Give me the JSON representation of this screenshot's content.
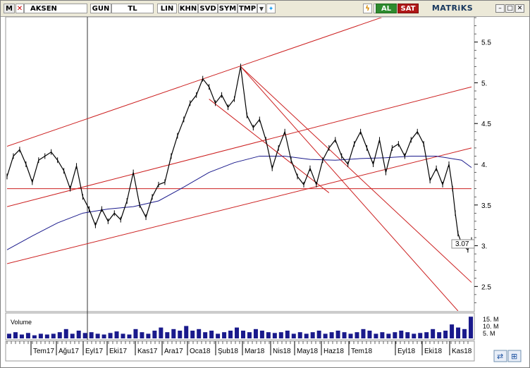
{
  "toolbar": {
    "logo": "M",
    "symbol": "AKSEN",
    "period": "GUN",
    "currency": "TL",
    "scale": "LIN",
    "buttons": [
      "KHN",
      "SVD",
      "SYM",
      "TMP"
    ],
    "buy": "AL",
    "sell": "SAT",
    "brand": "MATRiKS",
    "icons": [
      "close-icon",
      "dropdown-icon",
      "twitter-icon",
      "lightning-icon",
      "refresh-icon",
      "minimize-icon",
      "maximize-icon",
      "close-window-icon"
    ],
    "colors": {
      "buy": "#2e8b2e",
      "sell": "#b01818",
      "brand": "#17375e"
    }
  },
  "chart_data": {
    "type": "line",
    "title": "",
    "last_price": "3.07",
    "y_ticks": [
      "5.5",
      "5.",
      "4.5",
      "4.",
      "3.5",
      "3.",
      "2.5"
    ],
    "ylim": [
      2.2,
      5.8
    ],
    "x_labels": [
      "Tem17",
      "Ağu17",
      "Eyl17",
      "Eki17",
      "Kas17",
      "Ara17",
      "Oca18",
      "Şub18",
      "Mar18",
      "Nis18",
      "May18",
      "Haz18",
      "Tem18",
      "Eyl18",
      "Eki18",
      "Kas18"
    ],
    "x_range": [
      "2017-06-19",
      "2018-11-16"
    ],
    "volume_label": "Volume",
    "volume_ticks": [
      "15. M",
      "10. M",
      "5. M"
    ],
    "colors": {
      "price": "#000000",
      "moving_average": "#1a1a8c",
      "trendlines": "#cc2020",
      "volume": "#1a1a8c"
    },
    "price_series": [
      [
        "2017-06-19",
        3.85
      ],
      [
        "2017-06-26",
        4.1
      ],
      [
        "2017-07-03",
        4.18
      ],
      [
        "2017-07-10",
        4.0
      ],
      [
        "2017-07-17",
        3.78
      ],
      [
        "2017-07-24",
        4.05
      ],
      [
        "2017-07-31",
        4.1
      ],
      [
        "2017-08-07",
        4.15
      ],
      [
        "2017-08-14",
        4.05
      ],
      [
        "2017-08-21",
        3.92
      ],
      [
        "2017-08-28",
        3.7
      ],
      [
        "2017-09-04",
        3.98
      ],
      [
        "2017-09-11",
        3.6
      ],
      [
        "2017-09-18",
        3.45
      ],
      [
        "2017-09-25",
        3.25
      ],
      [
        "2017-10-02",
        3.45
      ],
      [
        "2017-10-09",
        3.3
      ],
      [
        "2017-10-16",
        3.4
      ],
      [
        "2017-10-23",
        3.32
      ],
      [
        "2017-10-30",
        3.55
      ],
      [
        "2017-11-06",
        3.9
      ],
      [
        "2017-11-13",
        3.5
      ],
      [
        "2017-11-20",
        3.35
      ],
      [
        "2017-11-27",
        3.6
      ],
      [
        "2017-12-04",
        3.75
      ],
      [
        "2017-12-11",
        3.78
      ],
      [
        "2017-12-18",
        4.1
      ],
      [
        "2017-12-25",
        4.35
      ],
      [
        "2018-01-01",
        4.55
      ],
      [
        "2018-01-08",
        4.75
      ],
      [
        "2018-01-15",
        4.85
      ],
      [
        "2018-01-22",
        5.05
      ],
      [
        "2018-01-29",
        4.95
      ],
      [
        "2018-02-05",
        4.75
      ],
      [
        "2018-02-12",
        4.85
      ],
      [
        "2018-02-19",
        4.7
      ],
      [
        "2018-02-26",
        4.8
      ],
      [
        "2018-03-05",
        5.2
      ],
      [
        "2018-03-12",
        4.6
      ],
      [
        "2018-03-19",
        4.45
      ],
      [
        "2018-03-26",
        4.55
      ],
      [
        "2018-04-02",
        4.3
      ],
      [
        "2018-04-09",
        3.95
      ],
      [
        "2018-04-16",
        4.2
      ],
      [
        "2018-04-23",
        4.4
      ],
      [
        "2018-04-30",
        4.05
      ],
      [
        "2018-05-07",
        3.85
      ],
      [
        "2018-05-14",
        3.75
      ],
      [
        "2018-05-21",
        3.95
      ],
      [
        "2018-05-28",
        3.75
      ],
      [
        "2018-06-04",
        4.05
      ],
      [
        "2018-06-11",
        4.2
      ],
      [
        "2018-06-18",
        4.3
      ],
      [
        "2018-06-25",
        4.1
      ],
      [
        "2018-07-02",
        4.0
      ],
      [
        "2018-07-09",
        4.25
      ],
      [
        "2018-07-16",
        4.4
      ],
      [
        "2018-07-23",
        4.2
      ],
      [
        "2018-07-30",
        4.0
      ],
      [
        "2018-08-06",
        4.3
      ],
      [
        "2018-08-13",
        3.9
      ],
      [
        "2018-08-20",
        4.2
      ],
      [
        "2018-08-27",
        4.25
      ],
      [
        "2018-09-03",
        4.1
      ],
      [
        "2018-09-10",
        4.3
      ],
      [
        "2018-09-17",
        4.4
      ],
      [
        "2018-09-24",
        4.25
      ],
      [
        "2018-10-01",
        3.8
      ],
      [
        "2018-10-08",
        3.95
      ],
      [
        "2018-10-15",
        3.75
      ],
      [
        "2018-10-22",
        4.0
      ],
      [
        "2018-10-26",
        3.7
      ],
      [
        "2018-10-29",
        3.4
      ],
      [
        "2018-11-01",
        3.15
      ],
      [
        "2018-11-06",
        3.0
      ],
      [
        "2018-11-12",
        2.95
      ],
      [
        "2018-11-16",
        3.07
      ]
    ],
    "moving_average": [
      [
        "2017-06-19",
        2.95
      ],
      [
        "2017-07-17",
        3.12
      ],
      [
        "2017-08-14",
        3.28
      ],
      [
        "2017-09-11",
        3.4
      ],
      [
        "2017-10-09",
        3.45
      ],
      [
        "2017-11-06",
        3.48
      ],
      [
        "2017-12-04",
        3.55
      ],
      [
        "2018-01-01",
        3.72
      ],
      [
        "2018-01-29",
        3.9
      ],
      [
        "2018-02-26",
        4.02
      ],
      [
        "2018-03-26",
        4.1
      ],
      [
        "2018-04-23",
        4.1
      ],
      [
        "2018-05-21",
        4.06
      ],
      [
        "2018-06-18",
        4.05
      ],
      [
        "2018-07-16",
        4.07
      ],
      [
        "2018-08-13",
        4.08
      ],
      [
        "2018-09-10",
        4.1
      ],
      [
        "2018-10-08",
        4.1
      ],
      [
        "2018-11-05",
        4.05
      ],
      [
        "2018-11-16",
        3.96
      ]
    ],
    "trendlines": [
      {
        "from": [
          "2017-06-19",
          4.22
        ],
        "to": [
          "2018-09-03",
          5.9
        ]
      },
      {
        "from": [
          "2017-06-19",
          3.48
        ],
        "to": [
          "2018-11-16",
          4.95
        ]
      },
      {
        "from": [
          "2017-06-19",
          2.78
        ],
        "to": [
          "2018-11-16",
          4.2
        ]
      },
      {
        "from": [
          "2017-06-19",
          3.7
        ],
        "to": [
          "2018-11-16",
          3.7
        ]
      },
      {
        "from": [
          "2018-01-29",
          4.8
        ],
        "to": [
          "2018-06-11",
          3.65
        ]
      },
      {
        "from": [
          "2018-03-05",
          5.2
        ],
        "to": [
          "2018-11-16",
          2.55
        ]
      },
      {
        "from": [
          "2018-03-05",
          5.2
        ],
        "to": [
          "2018-11-01",
          2.2
        ]
      }
    ],
    "volume_ylim": [
      0,
      15
    ],
    "volume_weekly_m": [
      3,
      4,
      2.5,
      3.5,
      2,
      3,
      2.5,
      3,
      4,
      6,
      3,
      5,
      3.5,
      4,
      3,
      2.5,
      3.5,
      4.5,
      3,
      2.5,
      6,
      4,
      3,
      5,
      7,
      4,
      6,
      5,
      8,
      5,
      6,
      4,
      5,
      3,
      4,
      5,
      7,
      5,
      4,
      6,
      5,
      4,
      3.5,
      4,
      5,
      3,
      4,
      3,
      4,
      5,
      3,
      4,
      5,
      4,
      3,
      4,
      6,
      5,
      3,
      4,
      3,
      4,
      5,
      4,
      3,
      3.5,
      4,
      6,
      4,
      5,
      9,
      7,
      6,
      14
    ]
  }
}
